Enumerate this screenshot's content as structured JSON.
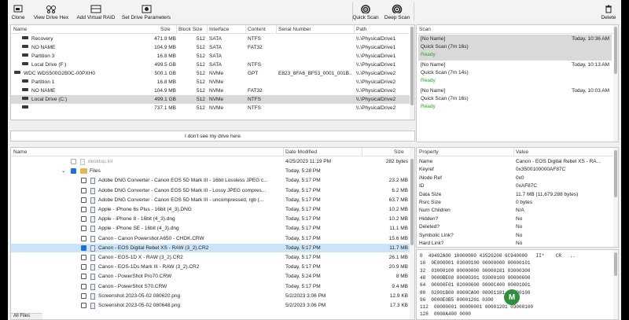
{
  "toolbar": {
    "clone": "Clone",
    "view_hex": "View Drive Hex",
    "add_raid": "Add Virtual RAID",
    "set_params": "Set Drive Parameters",
    "quick_scan": "Quick Scan",
    "deep_scan": "Deep Scan",
    "delete": "Delete"
  },
  "drives": {
    "headers": [
      "Name",
      "Size",
      "Block Size",
      "Interface",
      "Content",
      "Serial Number",
      "Path"
    ],
    "rows": [
      {
        "name": "Recovery",
        "size": "471.9 MB",
        "block": "512",
        "iface": "SATA",
        "content": "NTFS",
        "serial": "",
        "path": "\\\\.\\PhysicalDrive1"
      },
      {
        "name": "NO NAME",
        "size": "104.9 MB",
        "block": "512",
        "iface": "SATA",
        "content": "FAT32",
        "serial": "",
        "path": "\\\\.\\PhysicalDrive1"
      },
      {
        "name": "Partition 3",
        "size": "16.8 MB",
        "block": "512",
        "iface": "SATA",
        "content": "",
        "serial": "",
        "path": "\\\\.\\PhysicalDrive1"
      },
      {
        "name": "Local Drive (F:)",
        "size": "499.5 GB",
        "block": "512",
        "iface": "SATA",
        "content": "NTFS",
        "serial": "",
        "path": "\\\\.\\PhysicalDrive1"
      },
      {
        "name": "WDC WDS500G2B0C-00PXH0",
        "size": "500.1 GB",
        "block": "512",
        "iface": "NVMe",
        "content": "GPT",
        "serial": "E823_8FA6_BF53_0001_001B...",
        "path": "\\\\.\\PhysicalDrive2"
      },
      {
        "name": "Partition 1",
        "size": "16.8 MB",
        "block": "512",
        "iface": "NVMe",
        "content": "",
        "serial": "",
        "path": "\\\\.\\PhysicalDrive2"
      },
      {
        "name": "NO NAME",
        "size": "104.9 MB",
        "block": "512",
        "iface": "NVMe",
        "content": "FAT32",
        "serial": "",
        "path": "\\\\.\\PhysicalDrive2"
      },
      {
        "name": "Local Drive (C:)",
        "size": "499.1 GB",
        "block": "512",
        "iface": "NVMe",
        "content": "NTFS",
        "serial": "",
        "path": "\\\\.\\PhysicalDrive2"
      },
      {
        "name": "",
        "size": "737.1 MB",
        "block": "512",
        "iface": "NVMe",
        "content": "NTFS",
        "serial": "",
        "path": "\\\\.\\PhysicalDrive2"
      }
    ],
    "dont_see": "I don't see my drive here"
  },
  "scan": {
    "header": "Scan",
    "items": [
      {
        "name": "[No Name]",
        "time": "Today, 10:36 AM",
        "desc": "Quick Scan (7m 16s)",
        "status": "Ready"
      },
      {
        "name": "[No Name]",
        "time": "Today, 10:13 AM",
        "desc": "Quick Scan (7m 14s)",
        "status": "Ready"
      },
      {
        "name": "[No Name]",
        "time": "Today, 10:03 AM",
        "desc": "Quick Scan (7m 16s)",
        "status": "Ready"
      }
    ]
  },
  "files": {
    "headers": [
      "Name",
      "Date Modified",
      "Size"
    ],
    "rows": [
      {
        "name": "desktop.ini",
        "date": "4/25/2023 11:19 PM",
        "size": "282 bytes"
      },
      {
        "name": "Files",
        "date": "Today, 5:28 PM",
        "size": ""
      },
      {
        "name": "Adobe DNG Converter - Canon EOS 5D Mark III - 16bit Lossless JPEG c...",
        "date": "Today, 5:17 PM",
        "size": "23.2 MB"
      },
      {
        "name": "Adobe DNG Converter - Canon EOS 5D Mark III - Lossy JPEG compres...",
        "date": "Today, 5:17 PM",
        "size": "6.2 MB"
      },
      {
        "name": "Adobe DNG Converter - Canon EOS 5D Mark III - uncompressed, rgb (...",
        "date": "Today, 5:17 PM",
        "size": "63.7 MB"
      },
      {
        "name": "Apple - iPhone 6s Plus - 16bit (4_3).DNG",
        "date": "Today, 5:17 PM",
        "size": "10.2 MB"
      },
      {
        "name": "Apple - iPhone 8 - 16bit (4_3).dng",
        "date": "Today, 5:17 PM",
        "size": "10.2 MB"
      },
      {
        "name": "Apple - iPhone SE - 16bit (4_3).dng",
        "date": "Today, 5:17 PM",
        "size": "11.1 MB"
      },
      {
        "name": "Canon - Canon Powershot A650 - CHDK.CRW",
        "date": "Today, 5:17 PM",
        "size": "15.6 MB"
      },
      {
        "name": "Canon - EOS Digital Rebel XS - RAW (3_2).CR2",
        "date": "Today, 5:17 PM",
        "size": "11.7 MB"
      },
      {
        "name": "Canon - EOS-1D X - RAW (3_2).CR2",
        "date": "Today, 5:17 PM",
        "size": "26.1 MB"
      },
      {
        "name": "Canon - EOS-1Ds Mark III - RAW (3_2).CR2",
        "date": "Today, 5:17 PM",
        "size": "20.9 MB"
      },
      {
        "name": "Canon - PowerShot Pro70.CRW",
        "date": "Today, 5:24 PM",
        "size": "8 MB"
      },
      {
        "name": "Canon - PowerShot S70.CRW",
        "date": "Today, 5:17 PM",
        "size": "9.4 MB"
      },
      {
        "name": "Screenshot 2023-05-02 080620.png",
        "date": "5/2/2023 3:06 PM",
        "size": "12.9 KB"
      },
      {
        "name": "Screenshot 2023-05-02 080648.png",
        "date": "5/2/2023 3:06 PM",
        "size": "17.3 KB"
      }
    ],
    "status": "All Files"
  },
  "properties": {
    "headers": [
      "Property",
      "Value"
    ],
    "rows": [
      {
        "k": "Name",
        "v": "Canon - EOS Digital Rebel XS - RA..."
      },
      {
        "k": "Keyref",
        "v": "0x3500100000AF87C"
      },
      {
        "k": "iNode Ref",
        "v": "0x0"
      },
      {
        "k": "ID",
        "v": "0xAF87C"
      },
      {
        "k": "Data Size",
        "v": "11.7 MB (11,679,288 bytes)"
      },
      {
        "k": "Rsrc Size",
        "v": "0 bytes"
      },
      {
        "k": "Num Children",
        "v": "N/A"
      },
      {
        "k": "Hidden?",
        "v": "No"
      },
      {
        "k": "Deleted?",
        "v": "No"
      },
      {
        "k": "Symbolic Link?",
        "v": "No"
      },
      {
        "k": "Hard Link?",
        "v": "No"
      }
    ]
  },
  "hex": {
    "lines": [
      "0  49492A00 10000000 43520200 6C940000   II*    CR   ..",
      "16  0E000001 03000100 00000000 00000101",
      "32  03000100 00000000 00000201 03000300",
      "48  0000BE00 00000301 03000100 00000600",
      "64  00000F01 02000600 0000C400 00001001",
      "80  02001B00 0000CA00 00001101 04000100",
      "96  0000E0B5 00001201 0300",
      "112  00000001 00000001 00001201 03000100",
      "128  0000A400 0000"
    ]
  },
  "colors": {
    "accent": "#1e6fd9",
    "selected_row": "#cce4f7",
    "ready": "#22aa22"
  },
  "logo_letter": "M"
}
